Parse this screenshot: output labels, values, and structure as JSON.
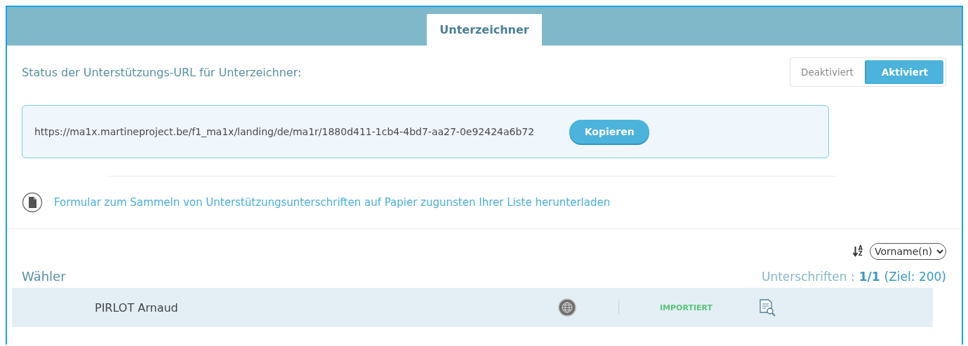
{
  "tabs": [
    {
      "label": "Unterzeichner",
      "selected": true
    }
  ],
  "status_label": "Status der Unterstützungs-URL für Unterzeichner:",
  "status_toggle": [
    {
      "label": "Deaktiviert",
      "selected": false
    },
    {
      "label": "Aktiviert",
      "selected": true
    }
  ],
  "url_box": {
    "url": "https://ma1x.martineproject.be/f1_ma1x/landing/de/ma1r/1880d411-1cb4-4bd7-aa27-0e92424a6b72",
    "copy_button": "Kopieren"
  },
  "download_link": "Formular zum Sammeln von Unterstützungsunterschriften auf Papier zugunsten Ihrer Liste herunterladen",
  "sort": {
    "letters": [
      "A",
      "Z"
    ],
    "value": "Vorname(n)"
  },
  "voters": {
    "title": "Wähler",
    "signatures_label": "Unterschriften :",
    "signatures_count": "1/1",
    "goal": "(Ziel: 200)",
    "rows": [
      {
        "name": "PIRLOT Arnaud",
        "status": "IMPORTIERT"
      }
    ]
  }
}
